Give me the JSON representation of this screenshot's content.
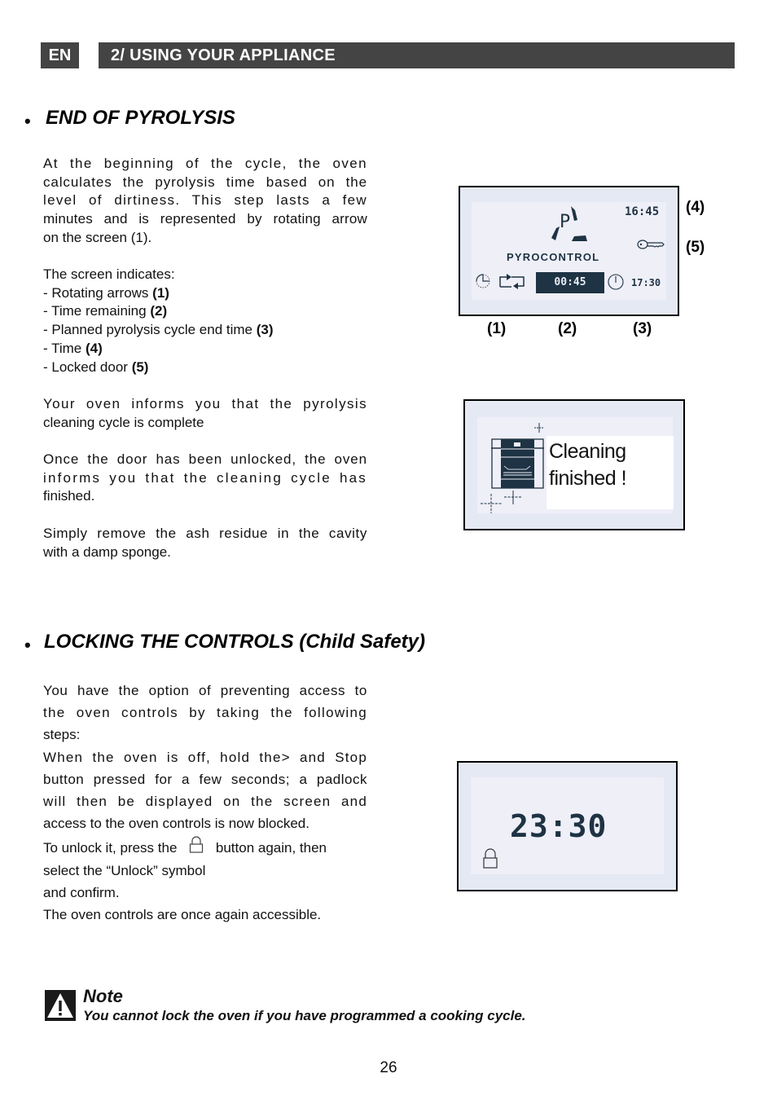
{
  "header": {
    "lang": "EN",
    "section": "2/ USING YOUR APPLIANCE"
  },
  "pyrolysis": {
    "bullet": "•",
    "title": "END OF PYROLYSIS",
    "intro_lines": [
      "At the beginning of the cycle, the oven",
      "calculates the pyrolysis time based on the",
      "level of dirtiness. This step lasts a few",
      "minutes and is represented by rotating arrow",
      "on the screen (1)."
    ],
    "indicates_label": "The screen indicates:",
    "indicators": [
      {
        "text": "- Rotating arrows ",
        "ref": "(1)"
      },
      {
        "text": "- Time remaining ",
        "ref": "(2)"
      },
      {
        "text": "- Planned pyrolysis cycle end time ",
        "ref": "(3)"
      },
      {
        "text": "- Time ",
        "ref": "(4)"
      },
      {
        "text": "- Locked door ",
        "ref": "(5)"
      }
    ],
    "complete_lines": [
      "Your oven informs you that the pyrolysis",
      "cleaning cycle is complete"
    ],
    "unlocked_lines": [
      "Once the door has been unlocked, the oven",
      "informs you that the cleaning cycle has",
      "finished."
    ],
    "remove_lines": [
      "Simply remove the ash residue in the cavity",
      "with a damp sponge."
    ],
    "display1": {
      "mode_letter": "P",
      "mode_label": "PYROCONTROL",
      "clock": "16:45",
      "remaining": "00:45",
      "end_time": "17:30",
      "icons": [
        "rotating-arrows",
        "loop-arrows",
        "clock",
        "key"
      ],
      "callouts": [
        "(1)",
        "(2)",
        "(3)",
        "(4)",
        "(5)"
      ]
    },
    "display2": {
      "message_line1": "Cleaning",
      "message_line2": "finished !"
    }
  },
  "locking": {
    "bullet": "•",
    "title": "LOCKING THE CONTROLS (Child Safety)",
    "lines": [
      "You have the option of preventing access to",
      "the oven controls by taking the following",
      "steps:",
      "When the oven is off, hold the> and Stop",
      "button pressed for a few seconds; a padlock",
      "will then be displayed on the screen and",
      "access to the oven controls is now blocked."
    ],
    "unlock_pre": "To unlock it, press the",
    "unlock_post": "button again, then",
    "unlock_line2": "select the “Unlock” symbol",
    "unlock_line3": "and confirm.",
    "final_line": "The oven controls are once again accessible.",
    "display3": {
      "clock": "23:30",
      "icon": "padlock"
    }
  },
  "note": {
    "title": "Note",
    "text": "You cannot lock the oven if you have programmed a cooking cycle."
  },
  "page_number": "26"
}
